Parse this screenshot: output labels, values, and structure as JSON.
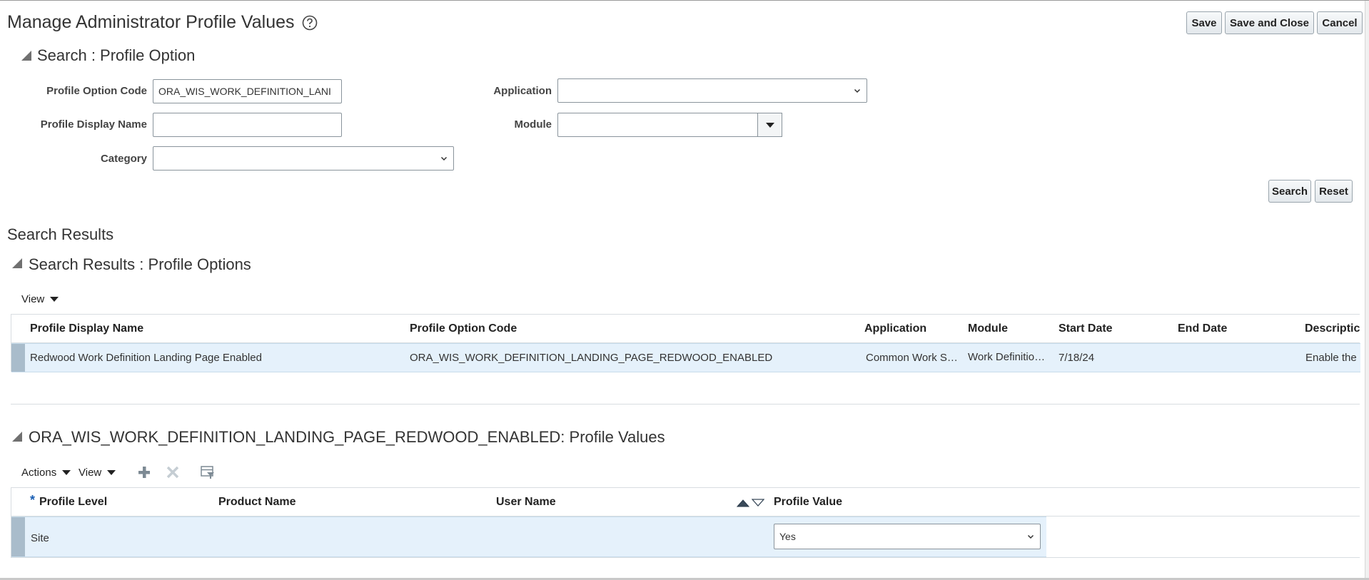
{
  "header": {
    "title": "Manage Administrator Profile Values",
    "buttons": {
      "save": "Save",
      "save_close": "Save and Close",
      "cancel": "Cancel"
    }
  },
  "search": {
    "section_title": "Search : Profile Option",
    "fields": {
      "profile_option_code": {
        "label": "Profile Option Code",
        "value": "ORA_WIS_WORK_DEFINITION_LANI"
      },
      "profile_display_name": {
        "label": "Profile Display Name",
        "value": ""
      },
      "category": {
        "label": "Category",
        "value": ""
      },
      "application": {
        "label": "Application",
        "value": ""
      },
      "module": {
        "label": "Module",
        "value": ""
      }
    },
    "buttons": {
      "search": "Search",
      "reset": "Reset"
    }
  },
  "results": {
    "page_heading": "Search Results",
    "section_title": "Search Results : Profile Options",
    "view_menu": "View",
    "columns": [
      "Profile Display Name",
      "Profile Option Code",
      "Application",
      "Module",
      "Start Date",
      "End Date",
      "Descriptic"
    ],
    "rows": [
      {
        "display_name": "Redwood Work Definition Landing Page Enabled",
        "code": "ORA_WIS_WORK_DEFINITION_LANDING_PAGE_REDWOOD_ENABLED",
        "application": "Common Work S…",
        "module": "Work Definitio…",
        "start_date": "7/18/24",
        "end_date": "",
        "description": "Enable the I"
      }
    ]
  },
  "values": {
    "section_title": "ORA_WIS_WORK_DEFINITION_LANDING_PAGE_REDWOOD_ENABLED: Profile Values",
    "actions_menu": "Actions",
    "view_menu": "View",
    "required_mark": "*",
    "columns": [
      "Profile Level",
      "Product Name",
      "User Name",
      "Profile Value"
    ],
    "rows": [
      {
        "profile_level": "Site",
        "product_name": "",
        "user_name": "",
        "profile_value": "Yes"
      }
    ]
  },
  "icons": [
    "help-icon",
    "collapse-triangle-icon",
    "chevron-down-icon",
    "caret-down-icon",
    "add-icon",
    "delete-icon",
    "query-by-example-icon",
    "sort-ascending-icon",
    "sort-descending-icon"
  ],
  "colors": {
    "selected_row": "#e5f1fb",
    "row_marker": "#a9bccb",
    "required": "#1a5fb4"
  }
}
